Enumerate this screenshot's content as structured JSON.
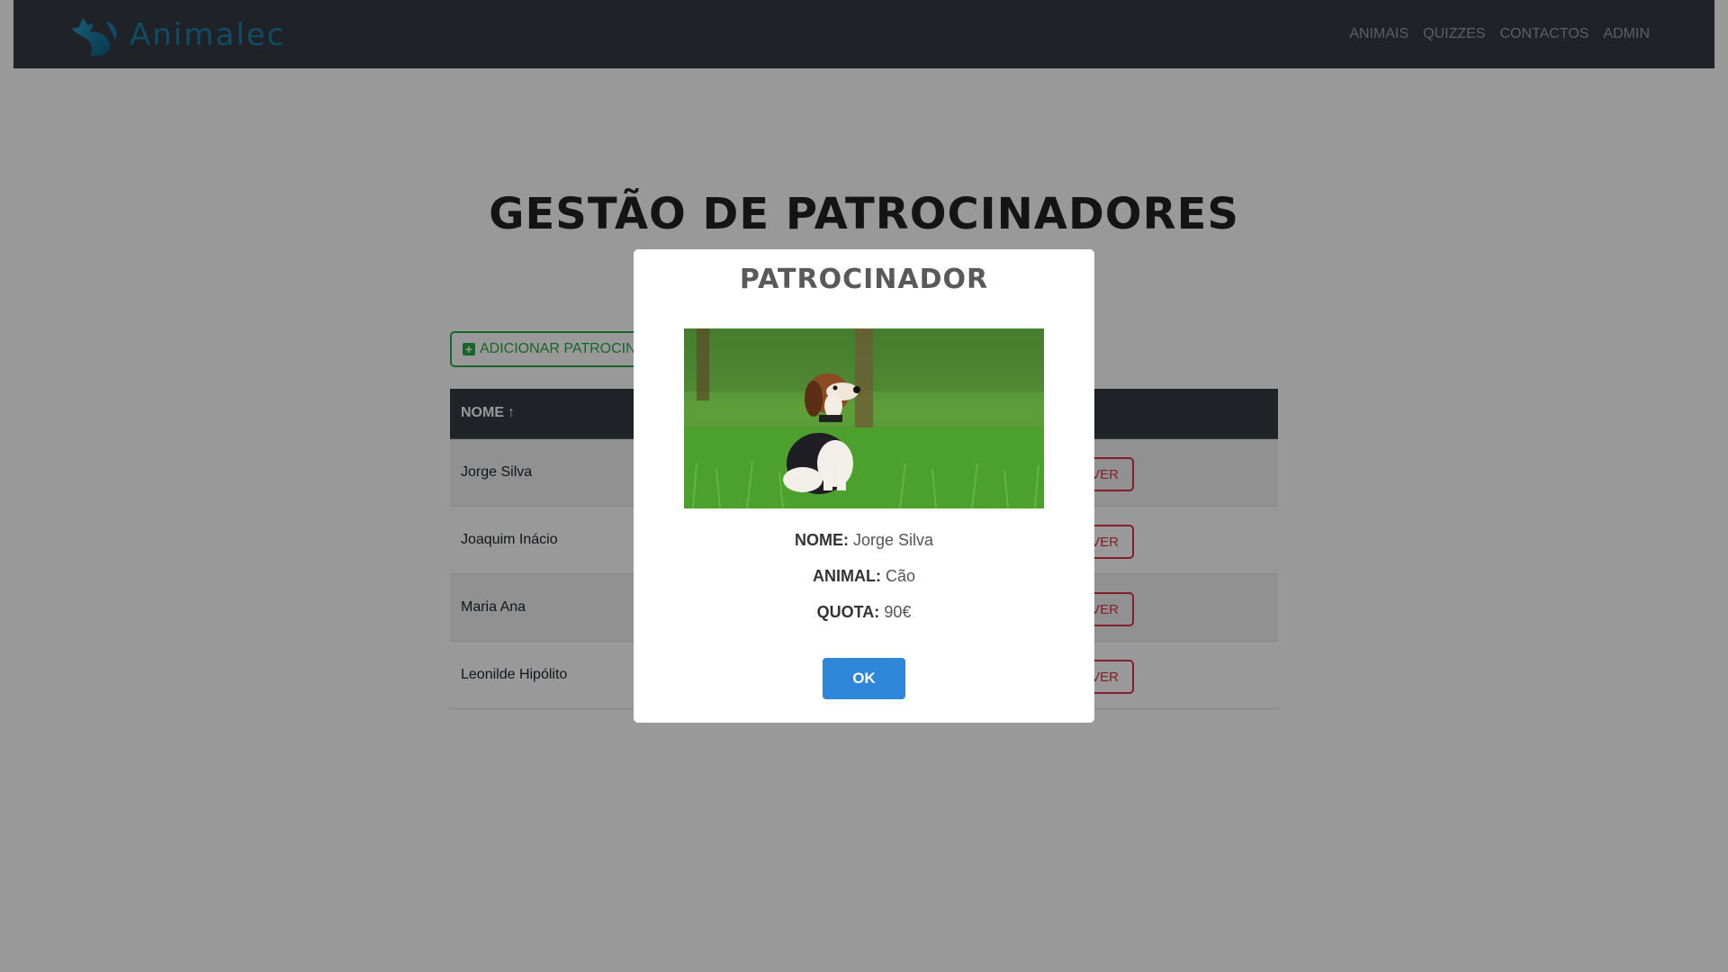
{
  "brand": {
    "name": "Animalec"
  },
  "nav": {
    "links": [
      "ANIMAIS",
      "QUIZZES",
      "CONTACTOS",
      "ADMIN"
    ]
  },
  "main": {
    "title": "GESTÃO DE PATROCINADORES",
    "add_button": "ADICIONAR PATROCINADOR",
    "table": {
      "header": "NOME",
      "rows": [
        "Jorge Silva",
        "Joaquim Inácio",
        "Maria Ana",
        "Leonilde Hipólito"
      ],
      "remove_label": "REMOVER"
    }
  },
  "modal": {
    "title": "PATROCINADOR",
    "image_icon": "dog-photo",
    "fields": {
      "nome_label": "NOME:",
      "nome_value": "Jorge Silva",
      "animal_label": "ANIMAL:",
      "animal_value": "Cão",
      "quota_label": "QUOTA:",
      "quota_value": "90€"
    },
    "ok_label": "OK"
  },
  "colors": {
    "navbar": "#343a40",
    "brand": "#1b7fa8",
    "success": "#28a745",
    "danger": "#dc3545",
    "primary": "#2f86d8"
  }
}
